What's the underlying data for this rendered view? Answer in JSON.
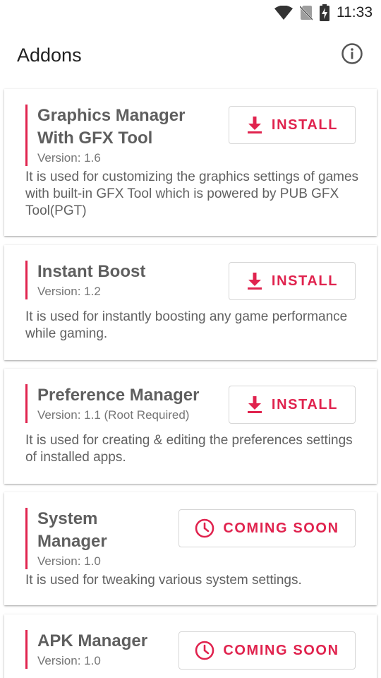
{
  "status_bar": {
    "time": "11:33",
    "icons": [
      "wifi-icon",
      "no-sim-icon",
      "battery-charging-icon"
    ]
  },
  "app_bar": {
    "title": "Addons",
    "info_icon": "info-icon"
  },
  "colors": {
    "accent": "#e0234e",
    "name_text": "#5f5f5f",
    "body_text": "#616161"
  },
  "addons": [
    {
      "name": "Graphics Manager With GFX Tool",
      "version": "Version: 1.6",
      "description": "It is used for customizing the graphics settings of games with built-in GFX Tool which is powered by PUB GFX Tool(PGT)",
      "button_label": "INSTALL",
      "button_icon": "download-icon"
    },
    {
      "name": "Instant Boost",
      "version": "Version: 1.2",
      "description": "It is used for instantly boosting any game performance while gaming.",
      "button_label": "INSTALL",
      "button_icon": "download-icon"
    },
    {
      "name": "Preference Manager",
      "version": "Version: 1.1 (Root Required)",
      "description": "It is used for creating & editing the preferences settings of installed apps.",
      "button_label": "INSTALL",
      "button_icon": "download-icon"
    },
    {
      "name": "System Manager",
      "version": "Version: 1.0",
      "description": "It is used for tweaking various system settings.",
      "button_label": "COMING SOON",
      "button_icon": "clock-icon"
    },
    {
      "name": "APK Manager",
      "version": "Version: 1.0",
      "description": "",
      "button_label": "COMING SOON",
      "button_icon": "clock-icon"
    }
  ]
}
